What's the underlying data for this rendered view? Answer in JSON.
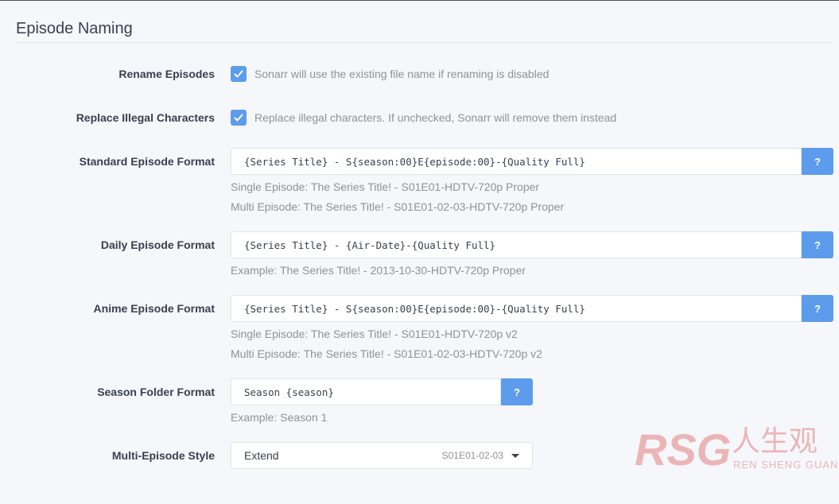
{
  "section": {
    "title": "Episode Naming"
  },
  "rename_episodes": {
    "label": "Rename Episodes",
    "checked": true,
    "help": "Sonarr will use the existing file name if renaming is disabled"
  },
  "replace_illegal": {
    "label": "Replace Illegal Characters",
    "checked": true,
    "help": "Replace illegal characters. If unchecked, Sonarr will remove them instead"
  },
  "standard_format": {
    "label": "Standard Episode Format",
    "value": "{Series Title} - S{season:00}E{episode:00}-{Quality Full}",
    "button": "?",
    "example1": "Single Episode: The Series Title! - S01E01-HDTV-720p Proper",
    "example2": "Multi Episode: The Series Title! - S01E01-02-03-HDTV-720p Proper"
  },
  "daily_format": {
    "label": "Daily Episode Format",
    "value": "{Series Title} - {Air-Date}-{Quality Full}",
    "button": "?",
    "example1": "Example: The Series Title! - 2013-10-30-HDTV-720p Proper"
  },
  "anime_format": {
    "label": "Anime Episode Format",
    "value": "{Series Title} - S{season:00}E{episode:00}-{Quality Full}",
    "button": "?",
    "example1": "Single Episode: The Series Title! - S01E01-HDTV-720p v2",
    "example2": "Multi Episode: The Series Title! - S01E01-02-03-HDTV-720p v2"
  },
  "season_folder": {
    "label": "Season Folder Format",
    "value": "Season {season}",
    "button": "?",
    "example1": "Example: Season 1"
  },
  "multi_episode_style": {
    "label": "Multi-Episode Style",
    "selected": "Extend",
    "hint": "S01E01-02-03"
  },
  "watermark": {
    "text_logo": "RSG",
    "text_cn": "人生观",
    "text_sub": "REN SHENG GUAN"
  },
  "colors": {
    "accent": "#5d9cec",
    "label": "#3a3f51",
    "help": "#909293",
    "watermark": "#e8a0a0"
  }
}
